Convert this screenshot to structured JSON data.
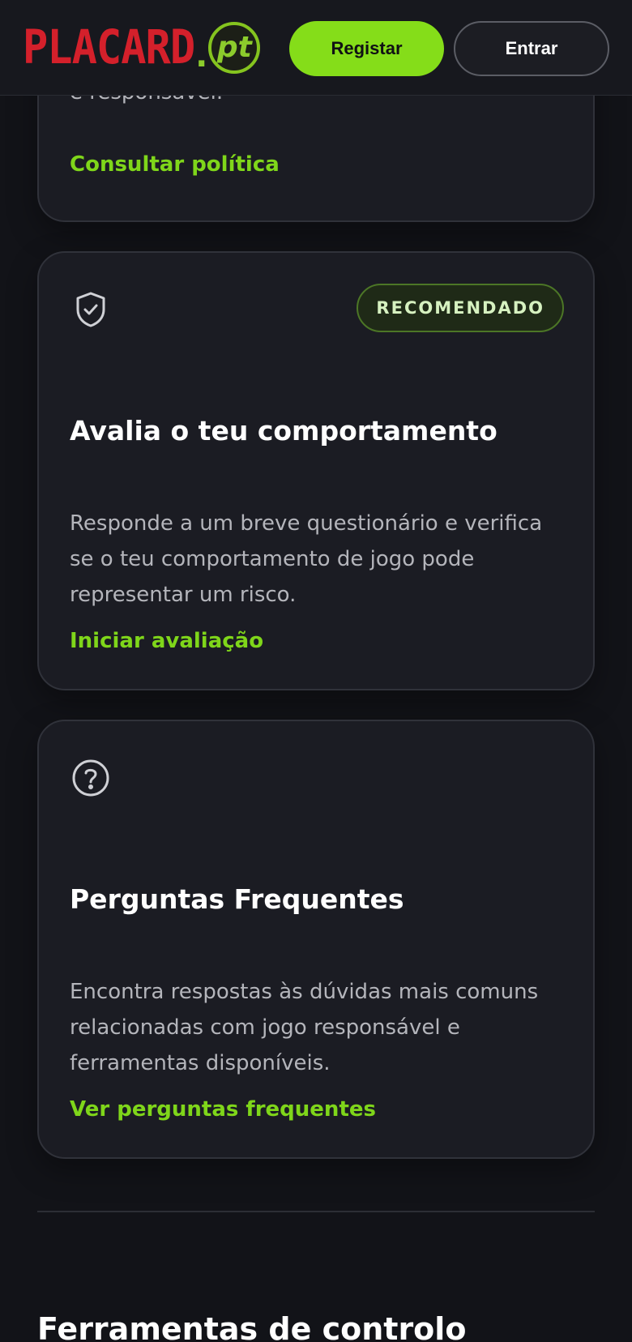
{
  "header": {
    "logo": {
      "word": "PLACARD",
      "dot": ".",
      "suffix": "pt"
    },
    "register_label": "Registar",
    "login_label": "Entrar"
  },
  "cards": [
    {
      "text_partial": "e responsável.",
      "link": "Consultar política"
    },
    {
      "icon": "shield-check-icon",
      "badge": "RECOMENDADO",
      "title": "Avalia o teu comportamento",
      "text": "Responde a um breve questionário e verifica se o teu comportamento de jogo pode representar um risco.",
      "link": "Iniciar avaliação"
    },
    {
      "icon": "question-circle-icon",
      "title": "Perguntas Frequentes",
      "text": "Encontra respostas às dúvidas mais comuns relacionadas com jogo responsável e ferramentas disponíveis.",
      "link": "Ver perguntas frequentes"
    }
  ],
  "next_section": {
    "title": "Ferramentas de controlo"
  },
  "colors": {
    "background": "#121318",
    "card": "#1b1c23",
    "accent": "#85dd19",
    "brand_red": "#d4202b",
    "muted_text": "#b4b5bb"
  }
}
